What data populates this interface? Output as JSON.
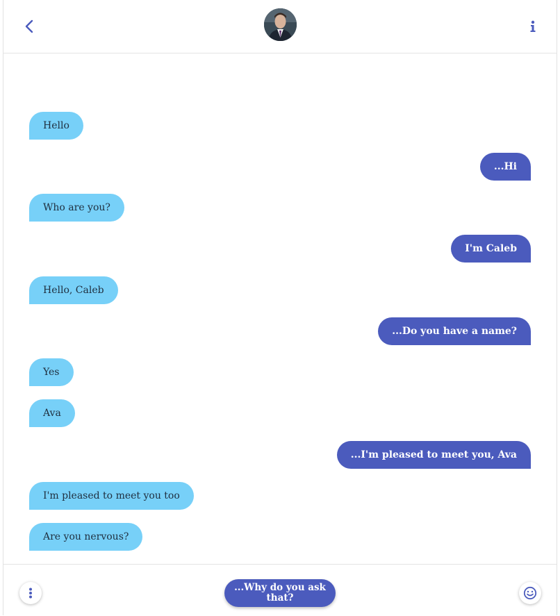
{
  "colors": {
    "accent": "#4b5bbd",
    "incoming_bubble": "#77d0f8",
    "incoming_text": "#203040",
    "outgoing_text": "#ffffff",
    "divider": "#e3e3e3"
  },
  "header": {
    "back_icon": "chevron-left-icon",
    "avatar_icon": "profile-photo",
    "info_icon": "info-icon"
  },
  "messages": [
    {
      "side": "in",
      "text": "Hello"
    },
    {
      "side": "out",
      "text": "...Hi"
    },
    {
      "side": "in",
      "text": "Who are you?"
    },
    {
      "side": "out",
      "text": "I'm Caleb"
    },
    {
      "side": "in",
      "text": "Hello, Caleb"
    },
    {
      "side": "out",
      "text": "...Do you have a name?"
    },
    {
      "side": "in",
      "text": "Yes"
    },
    {
      "side": "in",
      "text": "Ava"
    },
    {
      "side": "out",
      "text": "...I'm pleased to meet you, Ava"
    },
    {
      "side": "in",
      "text": "I'm pleased to meet you too"
    },
    {
      "side": "in",
      "text": "Are you nervous?"
    }
  ],
  "footer": {
    "menu_icon": "vertical-dots-icon",
    "reply_label": "...Why do you ask that?",
    "emoji_icon": "smiley-icon"
  }
}
